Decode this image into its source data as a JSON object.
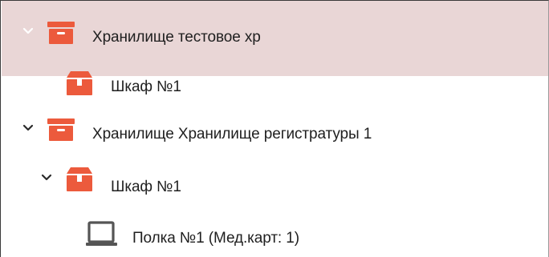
{
  "tree": {
    "nodes": [
      {
        "label": "Хранилище тестовое хр",
        "icon": "storage-box-icon",
        "expander": "chevron-down-icon",
        "expander_color": "#ffffff",
        "selected": true
      },
      {
        "label": "Шкаф №1",
        "icon": "cabinet-icon",
        "expander": "none"
      },
      {
        "label": "Хранилище Хранилище регистратуры 1",
        "icon": "storage-box-icon",
        "expander": "chevron-down-icon",
        "expander_color": "#2b2b2b"
      },
      {
        "label": "Шкаф №1",
        "icon": "cabinet-icon",
        "expander": "chevron-down-icon",
        "expander_color": "#2b2b2b"
      },
      {
        "label": "Полка №1 (Мед.карт: 1)",
        "icon": "shelf-laptop-icon",
        "expander": "none"
      }
    ]
  },
  "colors": {
    "accent_red": "#ec5a3c",
    "selected_row_bg": "#e9d6d6",
    "text": "#1f1f1f",
    "shelf_icon": "#555555"
  }
}
